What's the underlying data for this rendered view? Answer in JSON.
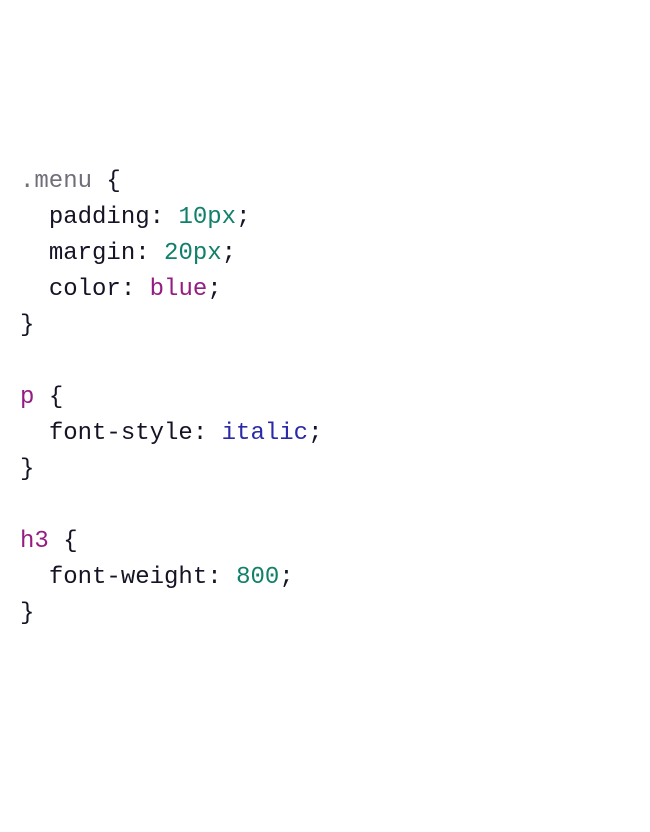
{
  "code": {
    "rule1": {
      "selector": ".menu",
      "decls": [
        {
          "prop": "padding",
          "value": "10px"
        },
        {
          "prop": "margin",
          "value": "20px"
        },
        {
          "prop": "color",
          "value": "blue"
        }
      ]
    },
    "rule2": {
      "selector": "p",
      "decls": [
        {
          "prop": "font-style",
          "value": "italic"
        }
      ]
    },
    "rule3": {
      "selector": "h3",
      "decls": [
        {
          "prop": "font-weight",
          "value": "800"
        }
      ]
    }
  },
  "tokens": {
    "brace_open": "{",
    "brace_close": "}",
    "colon": ":",
    "semicolon": ";",
    "space": " ",
    "indent": "  "
  }
}
